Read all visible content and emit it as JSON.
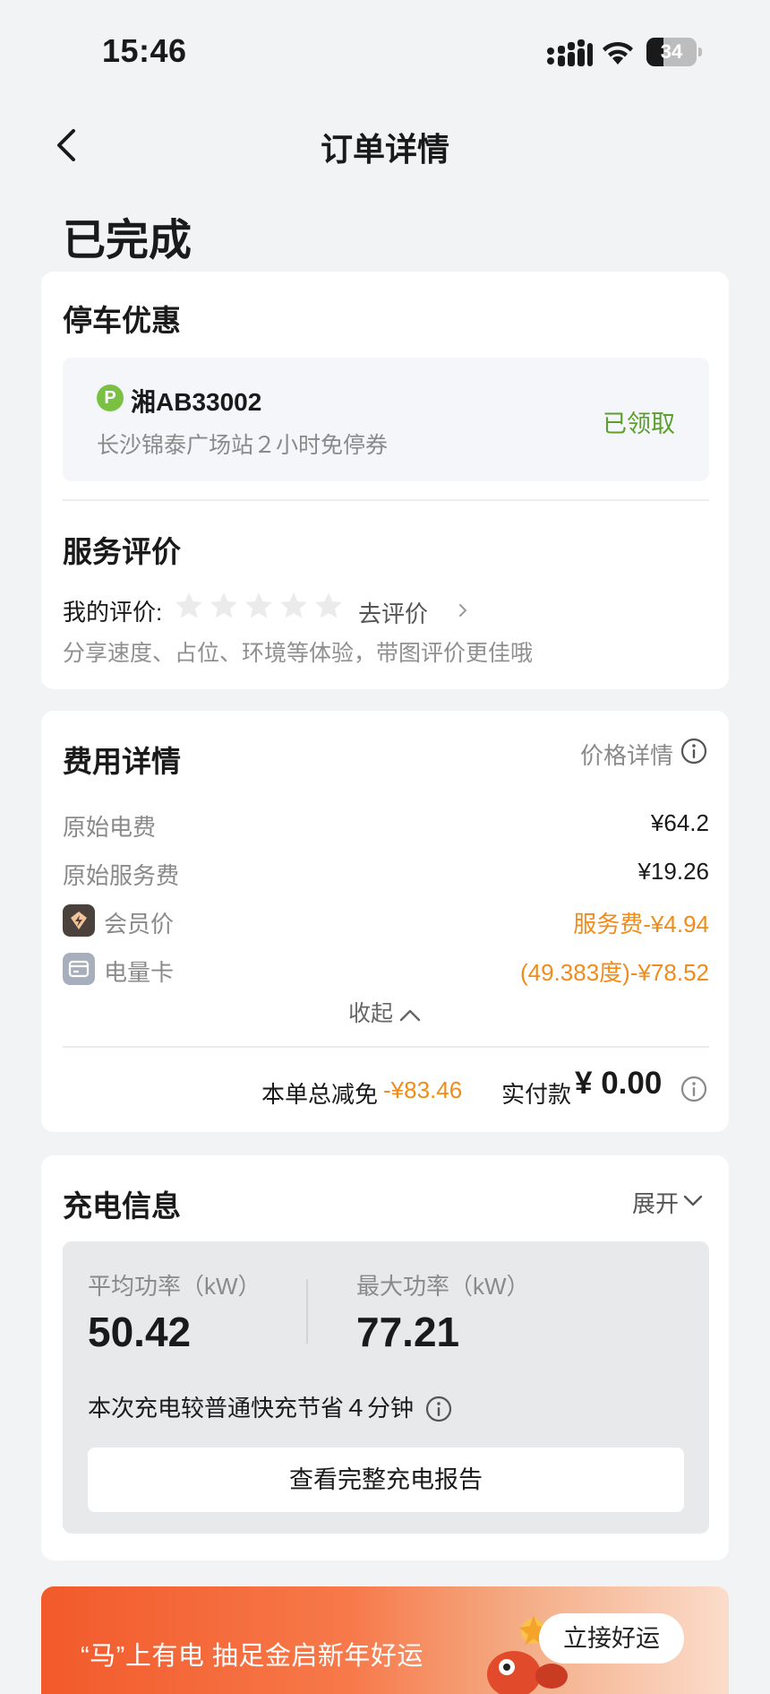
{
  "status_bar": {
    "time": "15:46",
    "battery": "34",
    "battery_level": 0.34
  },
  "nav": {
    "title": "订单详情"
  },
  "order_status": "已完成",
  "parking": {
    "title": "停车优惠",
    "p_badge": "P",
    "plate": "湘AB33002",
    "coupon_desc": "长沙锦泰广场站２小时免停券",
    "coupon_status": "已领取"
  },
  "review": {
    "title": "服务评价",
    "my_rating_label": "我的评价:",
    "rating": 0,
    "star_count": 5,
    "go_rate_label": "去评价",
    "hint": "分享速度、占位、环境等体验，带图评价更佳哦"
  },
  "fees": {
    "title": "费用详情",
    "price_detail_label": "价格详情",
    "rows": [
      {
        "label": "原始电费",
        "value": "¥64.2"
      },
      {
        "label": "原始服务费",
        "value": "¥19.26"
      },
      {
        "label": "会员价",
        "value": "服务费-¥4.94",
        "icon": "member-diamond-icon"
      },
      {
        "label": "电量卡",
        "value": "(49.383度)-¥78.52",
        "icon": "card-icon"
      }
    ],
    "collapse_label": "收起",
    "total_discount_label": "本单总减免",
    "total_discount_value": "-¥83.46",
    "paid_label": "实付款",
    "paid_value": "¥ 0.00"
  },
  "charging": {
    "title": "充电信息",
    "expand_label": "展开",
    "avg_power_label": "平均功率（kW）",
    "avg_power_value": "50.42",
    "max_power_label": "最大功率（kW）",
    "max_power_value": "77.21",
    "save_note": "本次充电较普通快充节省４分钟",
    "report_button": "查看完整充电报告"
  },
  "banner": {
    "text": "“马”上有电 抽足金启新年好运",
    "button": "立接好运"
  },
  "colors": {
    "orange": "#f08c1b",
    "green": "#5aa02c",
    "background": "#f2f3f5"
  }
}
